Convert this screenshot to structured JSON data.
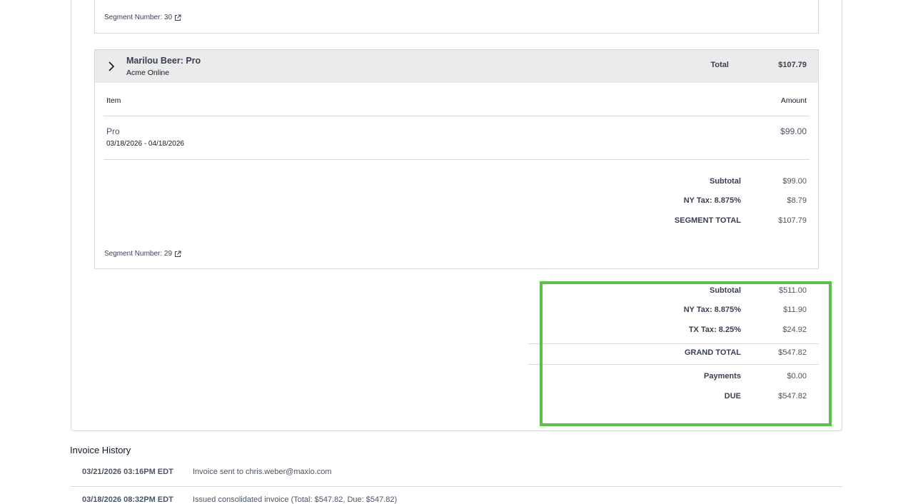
{
  "previous_segment": {
    "segment_number": "Segment Number: 30"
  },
  "segment": {
    "title": "Marilou Beer: Pro",
    "subtitle": "Acme Online",
    "total_label": "Total",
    "total_value": "$107.79",
    "columns": {
      "item": "Item",
      "amount": "Amount"
    },
    "line_item": {
      "name": "Pro",
      "dates": "03/18/2026 - 04/18/2026",
      "amount": "$99.00"
    },
    "summary": [
      {
        "label": "Subtotal",
        "value": "$99.00"
      },
      {
        "label": "NY Tax: 8.875%",
        "value": "$8.79"
      },
      {
        "label": "SEGMENT TOTAL",
        "value": "$107.79"
      }
    ],
    "segment_number": "Segment Number: 29"
  },
  "invoice_totals": {
    "subtotal": {
      "label": "Subtotal",
      "value": "$511.00"
    },
    "ny_tax": {
      "label": "NY Tax: 8.875%",
      "value": "$11.90"
    },
    "tx_tax": {
      "label": "TX Tax: 8.25%",
      "value": "$24.92"
    },
    "grand_total": {
      "label": "GRAND TOTAL",
      "value": "$547.82"
    },
    "payments": {
      "label": "Payments",
      "value": "$0.00"
    },
    "due": {
      "label": "DUE",
      "value": "$547.82"
    }
  },
  "invoice_history": {
    "title": "Invoice History",
    "entries": [
      {
        "date": "03/21/2026 03:16PM EDT",
        "text": "Invoice sent to chris.weber@maxio.com"
      },
      {
        "date": "03/18/2026 08:32PM EDT",
        "text": "Issued consolidated invoice (Total: $547.82, Due: $547.82)"
      }
    ]
  },
  "colors": {
    "highlight": "#5cc04a",
    "segment_header_bg": "#ebebeb",
    "border": "#d9d9d9"
  },
  "icons": [
    "external-link-icon",
    "chevron-right-icon"
  ]
}
